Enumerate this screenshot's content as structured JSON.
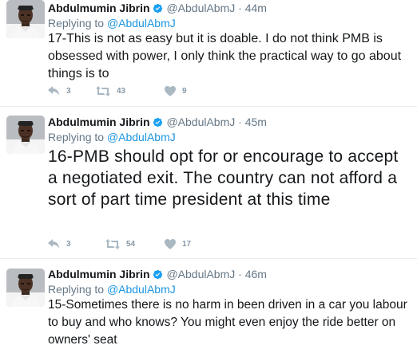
{
  "tweets": [
    {
      "name": "Abdulmumin Jibrin",
      "handle": "@AbdulAbmJ",
      "dot": "·",
      "time": "44m",
      "replying_prefix": "Replying to",
      "replying_to": "@AbdulAbmJ",
      "text": "17-This is not as easy but it is doable. I do not think PMB is obsessed with power, I only think the practical way to go about things is to",
      "replies": "3",
      "retweets": "43",
      "likes": "9"
    },
    {
      "name": "Abdulmumin Jibrin",
      "handle": "@AbdulAbmJ",
      "dot": "·",
      "time": "45m",
      "replying_prefix": "Replying to",
      "replying_to": "@AbdulAbmJ",
      "text": "16-PMB should opt for or encourage to accept a negotiated exit. The country can not afford a sort of part time president at this time",
      "replies": "3",
      "retweets": "54",
      "likes": "17"
    },
    {
      "name": "Abdulmumin Jibrin",
      "handle": "@AbdulAbmJ",
      "dot": "·",
      "time": "46m",
      "replying_prefix": "Replying to",
      "replying_to": "@AbdulAbmJ",
      "text": "15-Sometimes there is no harm in been driven in a car you labour to buy and who knows? You might even enjoy the ride better on owners' seat",
      "replies": "",
      "retweets": "",
      "likes": ""
    }
  ],
  "icons": {
    "verified": "verified-badge-icon",
    "reply": "reply-icon",
    "retweet": "retweet-icon",
    "like": "heart-icon"
  },
  "colors": {
    "link": "#1b95e0",
    "verified": "#1da1f2",
    "muted": "#657786",
    "action": "#aab8c2"
  }
}
